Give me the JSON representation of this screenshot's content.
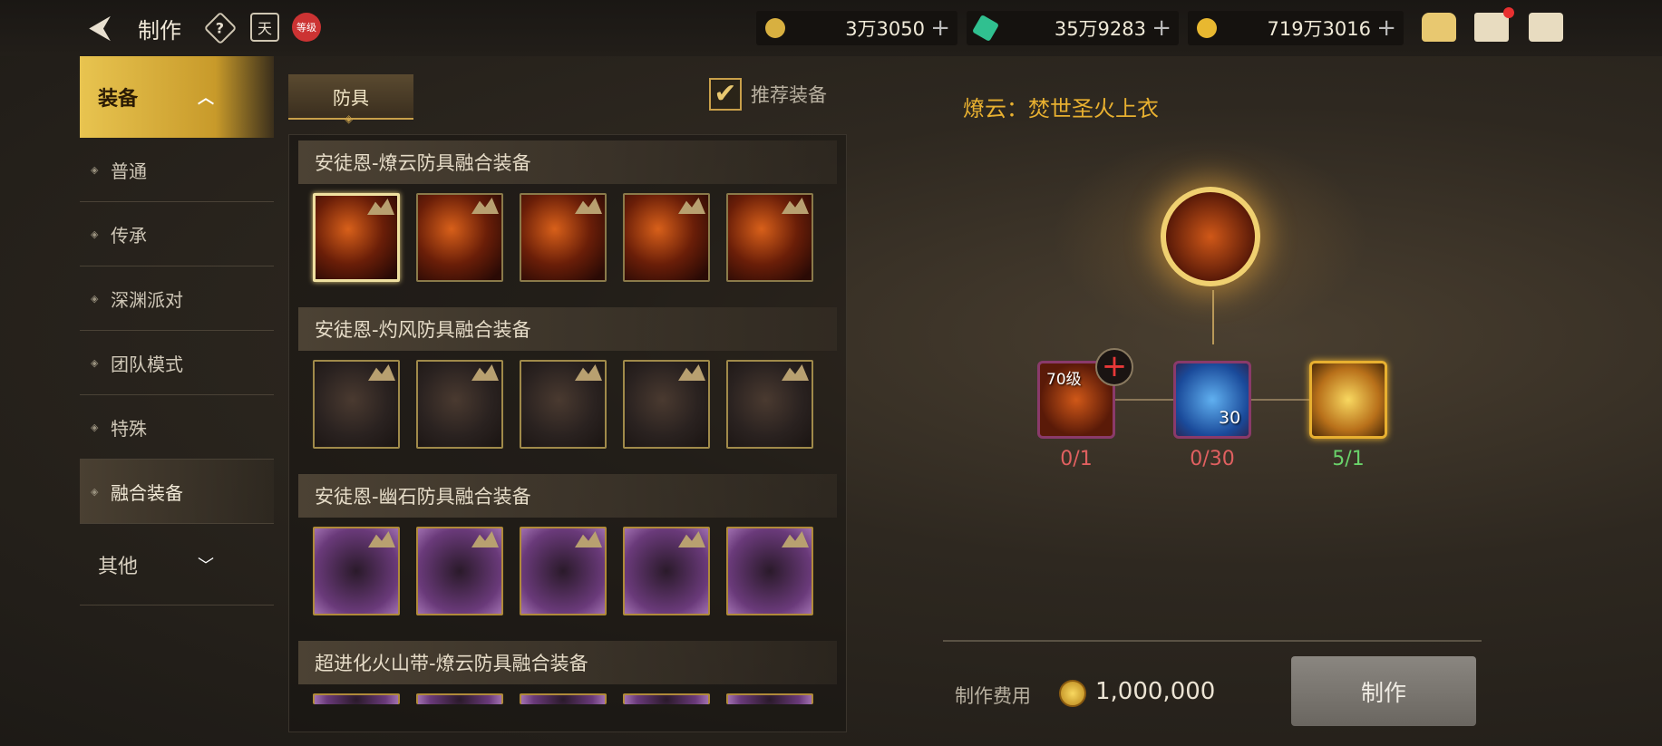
{
  "header": {
    "title": "制作",
    "calendar_char": "天",
    "level_badge": "等级",
    "currencies": [
      {
        "name": "coin-c",
        "value": "3万3050",
        "color": "#d8b040"
      },
      {
        "name": "gem",
        "value": "35万9283",
        "color": "#30c090"
      },
      {
        "name": "gold",
        "value": "719万3016",
        "color": "#e8b830"
      }
    ],
    "plus": "+"
  },
  "sidebar": {
    "head": "装备",
    "items": [
      {
        "label": "普通"
      },
      {
        "label": "传承"
      },
      {
        "label": "深渊派对"
      },
      {
        "label": "团队模式"
      },
      {
        "label": "特殊"
      },
      {
        "label": "融合装备",
        "active": true
      }
    ],
    "other": "其他"
  },
  "tabs": {
    "armor": "防具"
  },
  "recommend": {
    "label": "推荐装备",
    "checked": true
  },
  "groups": [
    {
      "title": "安徒恩-燎云防具融合装备",
      "style": "fire",
      "count": 5
    },
    {
      "title": "安徒恩-灼风防具融合装备",
      "style": "ash",
      "count": 5
    },
    {
      "title": "安徒恩-幽石防具融合装备",
      "style": "purp",
      "count": 5
    },
    {
      "title": "超进化火山带-燎云防具融合装备",
      "style": "purp",
      "count": 5
    }
  ],
  "detail": {
    "title": "燎云：焚世圣火上衣",
    "materials": [
      {
        "tag": "70级",
        "count": "0/1",
        "status": "red"
      },
      {
        "qty": "30",
        "count": "0/30",
        "status": "red"
      },
      {
        "count": "5/1",
        "status": "green"
      }
    ],
    "cost_label": "制作费用",
    "cost_value": "1,000,000",
    "make_button": "制作"
  }
}
